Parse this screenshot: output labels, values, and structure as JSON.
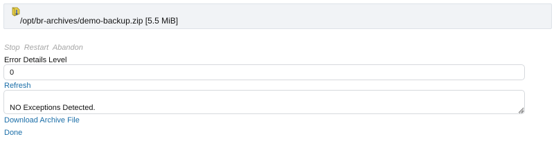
{
  "archive": {
    "icon": "zip-archive-icon",
    "path": "/opt/br-archives/demo-backup.zip [5.5 MiB]"
  },
  "actions": {
    "stop": "Stop",
    "restart": "Restart",
    "abandon": "Abandon"
  },
  "error_details": {
    "label": "Error Details Level",
    "value": "0"
  },
  "links": {
    "refresh": "Refresh",
    "download": "Download Archive File",
    "done": "Done"
  },
  "exceptions": {
    "text": "NO Exceptions Detected."
  },
  "colors": {
    "link": "#1b6ea8",
    "disabled_action": "#a7a7a7",
    "panel_background": "#f1f3f6"
  }
}
